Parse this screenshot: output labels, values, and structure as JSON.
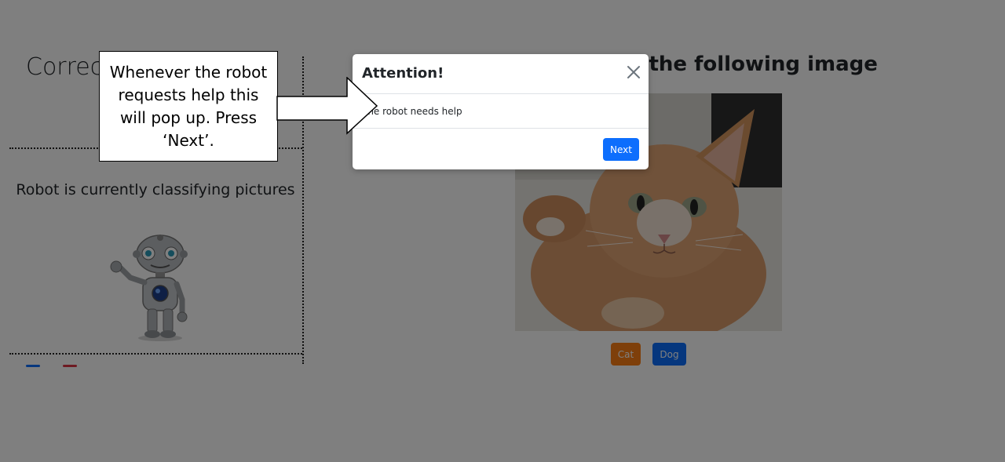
{
  "left_panel": {
    "score_label": "Correct: 0/9",
    "status_text": "Robot is currently classifying pictures"
  },
  "main": {
    "heading": "Please classify the following image",
    "options": [
      {
        "label": "Cat",
        "color": "#fd7e14"
      },
      {
        "label": "Dog",
        "color": "#0d6efd"
      }
    ]
  },
  "modal": {
    "title": "Attention!",
    "message": "The robot needs help",
    "next_label": "Next",
    "close_icon": "close-icon"
  },
  "tutorial": {
    "callout_text": "Whenever the robot requests help this will pop up. Press ‘Next’."
  },
  "colors": {
    "backdrop": "rgba(0,0,0,0.5)",
    "primary": "#0d6efd",
    "cat_button": "#fd7e14"
  }
}
